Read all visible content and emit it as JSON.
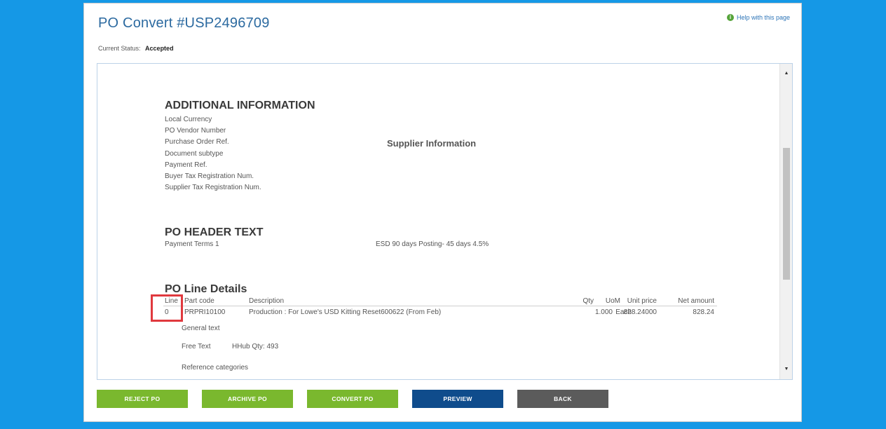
{
  "header": {
    "title": "PO Convert #USP2496709",
    "help_link": "Help with this page",
    "status_label": "Current Status:",
    "status_value": "Accepted"
  },
  "document": {
    "additional_info": {
      "title": "ADDITIONAL INFORMATION",
      "fields": [
        "Local Currency",
        "PO Vendor Number",
        "Purchase Order Ref.",
        "Document subtype",
        "Payment Ref.",
        "Buyer Tax Registration Num.",
        "Supplier Tax Registration Num."
      ]
    },
    "supplier_info_label": "Supplier Information",
    "po_header_text": {
      "title": "PO HEADER TEXT",
      "label": "Payment Terms 1",
      "value": "ESD 90 days Posting- 45 days 4.5%"
    },
    "po_line_details": {
      "title": "PO Line Details",
      "columns": {
        "line": "Line",
        "part_code": "Part code",
        "description": "Description",
        "qty": "Qty",
        "uom": "UoM",
        "unit_price": "Unit price",
        "net_amount": "Net amount"
      },
      "rows": [
        {
          "line": "0",
          "part_code": "PRPRI10100",
          "description": "Production : For Lowe's USD Kitting Reset600622 (From Feb)",
          "qty": "1.000",
          "uom": "Each",
          "unit_price": "828.24000",
          "net_amount": "828.24"
        }
      ],
      "general_text": "General text",
      "free_text_label": "Free Text",
      "free_text_value": "HHub Qty: 493",
      "reference_categories": "Reference categories"
    }
  },
  "actions": {
    "reject": "REJECT PO",
    "archive": "ARCHIVE PO",
    "convert": "CONVERT PO",
    "preview": "PREVIEW",
    "back": "BACK"
  },
  "colors": {
    "background": "#1598e6",
    "title": "#2c6aa0",
    "green_button": "#7ab82e",
    "blue_button": "#0f4c8c",
    "gray_button": "#5b5b5b",
    "highlight": "#e0393e"
  }
}
